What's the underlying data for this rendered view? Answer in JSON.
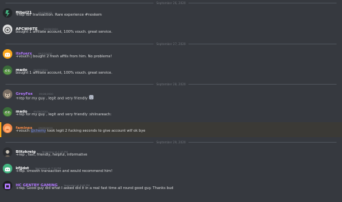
{
  "colors": {
    "background": "#36393f",
    "author_default": "#ffffff",
    "author_purple": "#b278ff",
    "author_orange": "#f48a49",
    "timestamp": "#72767d",
    "divider_text": "#72767d",
    "highlight_bar": "#faa61a"
  },
  "dividers": [
    {
      "date": "September 26, 2020"
    },
    {
      "date": "September 27, 2020"
    },
    {
      "date": "September 28, 2020"
    },
    {
      "date": "September 29, 2020"
    }
  ],
  "messages": [
    {
      "author": "fitbol21",
      "timestamp": "09/26/2020",
      "text": "+rep fair transaction. Rare experience #noskem",
      "avatar_icon": "lightning-logo-icon"
    },
    {
      "author": "APCWHITE",
      "timestamp": "09/26/2020",
      "text": "bought 1 affiliate account, 100% vouch. great service.",
      "avatar_icon": "emblem-avatar-icon"
    },
    {
      "author": "itsfuerx",
      "timestamp": "09/27/2020",
      "text": "+vouch | bought 2 fresh affils from him. No problems!",
      "avatar_icon": "discord-default-avatar-icon"
    },
    {
      "author": "mado",
      "timestamp": "09/27/2020",
      "text": "bought 1 affiliate account, 100% vouch. great service.",
      "avatar_icon": "pepe-avatar-icon"
    },
    {
      "author": "GreyFox",
      "timestamp": "09/28/2020",
      "text": "+rep for my guy , legit and very friendly",
      "avatar_icon": "fox-avatar-icon",
      "emoji_icon": "emoji-icon"
    },
    {
      "author": "mado",
      "timestamp": "09/28/2020",
      "text": "+rep for my guy , legit and very friendly :shiinareach:",
      "avatar_icon": "pepe-avatar-icon"
    },
    {
      "author": "famines",
      "timestamp": "09/28/2020",
      "text_before": "+vouch ",
      "mention": "@chemy",
      "text_after": " took legit 2 fucking seconds to give account wtf ok bye",
      "avatar_icon": "orange-avatar-icon"
    },
    {
      "author": "Blitzkreig",
      "timestamp": "Yesterday at 1:15 PM",
      "text": "+rep , fast, friendly, helpful, informative",
      "avatar_icon": "portrait-avatar-icon"
    },
    {
      "author": "kfjjdst",
      "timestamp": "Yesterday at 7:10 PM",
      "text": "+rep. smooth transaction and would recommend him!",
      "avatar_icon": "discord-green-avatar-icon"
    },
    {
      "author": "HC GENTRY GAMING",
      "timestamp": "Yesterday at 8:46 PM",
      "text": "+rep. Good guy did what I asked did it in a real fast time all round good guy. Thanks bud",
      "avatar_icon": "gentry-avatar-icon"
    }
  ]
}
